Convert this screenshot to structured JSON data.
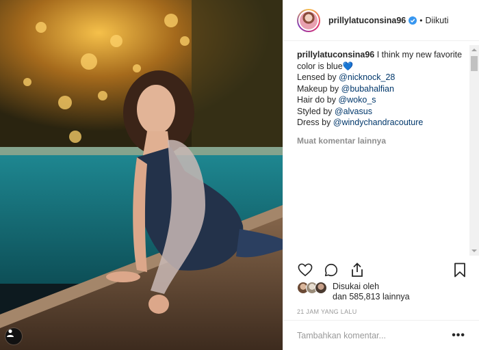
{
  "post": {
    "username": "prillylatuconsina96",
    "follow_status": "Diikuti",
    "dot": "•"
  },
  "caption": {
    "username": "prillylatuconsina96",
    "line1": " I think my new favorite color is blue",
    "heart": "💙",
    "credits": [
      {
        "prefix": "Lensed by ",
        "mention": "@nicknock_28"
      },
      {
        "prefix": "Makeup by ",
        "mention": "@bubahalfian"
      },
      {
        "prefix": "Hair do by ",
        "mention": "@woko_s"
      },
      {
        "prefix": "Styled by ",
        "mention": "@alvasus"
      },
      {
        "prefix": "Dress by ",
        "mention": "@windychandracouture"
      }
    ]
  },
  "load_more_comments": "Muat komentar lainnya",
  "likes": {
    "line1": "Disukai oleh",
    "line2": "dan 585,813 lainnya"
  },
  "timestamp": "21 JAM YANG LALU",
  "comment_input": {
    "placeholder": "Tambahkan komentar..."
  },
  "more_options": "•••",
  "icons": {
    "like": "heart-icon",
    "comment": "comment-icon",
    "share": "share-icon",
    "save": "bookmark-icon",
    "verified": "verified-badge-icon",
    "tag": "user-tag-icon"
  },
  "colors": {
    "mention": "#00376b",
    "verified": "#3897f0",
    "muted": "#8e8e8e"
  }
}
